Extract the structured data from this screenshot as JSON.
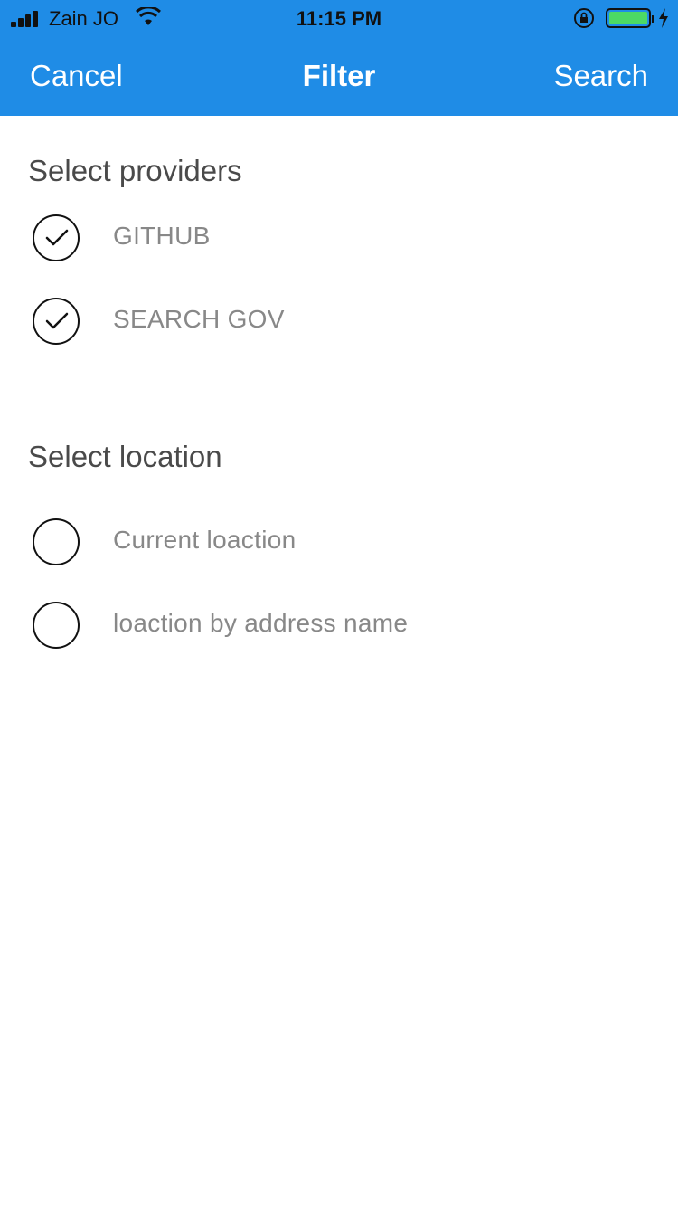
{
  "status_bar": {
    "carrier": "Zain JO",
    "time": "11:15 PM",
    "battery_level": 1.0,
    "charging": true,
    "icons": [
      "signal-icon",
      "wifi-icon",
      "rotation-lock-icon",
      "battery-icon",
      "charging-bolt-icon"
    ]
  },
  "nav": {
    "cancel_label": "Cancel",
    "title": "Filter",
    "search_label": "Search"
  },
  "providers": {
    "title": "Select providers",
    "items": [
      {
        "label": "GITHUB",
        "checked": true
      },
      {
        "label": "SEARCH GOV",
        "checked": true
      }
    ]
  },
  "location": {
    "title": "Select location",
    "items": [
      {
        "label": "Current loaction",
        "checked": false
      },
      {
        "label": "loaction by address name",
        "checked": false
      }
    ]
  },
  "colors": {
    "header": "#1f8ce6",
    "battery": "#4cd964",
    "label_text": "#888888",
    "section_text": "#4a4a4a"
  }
}
